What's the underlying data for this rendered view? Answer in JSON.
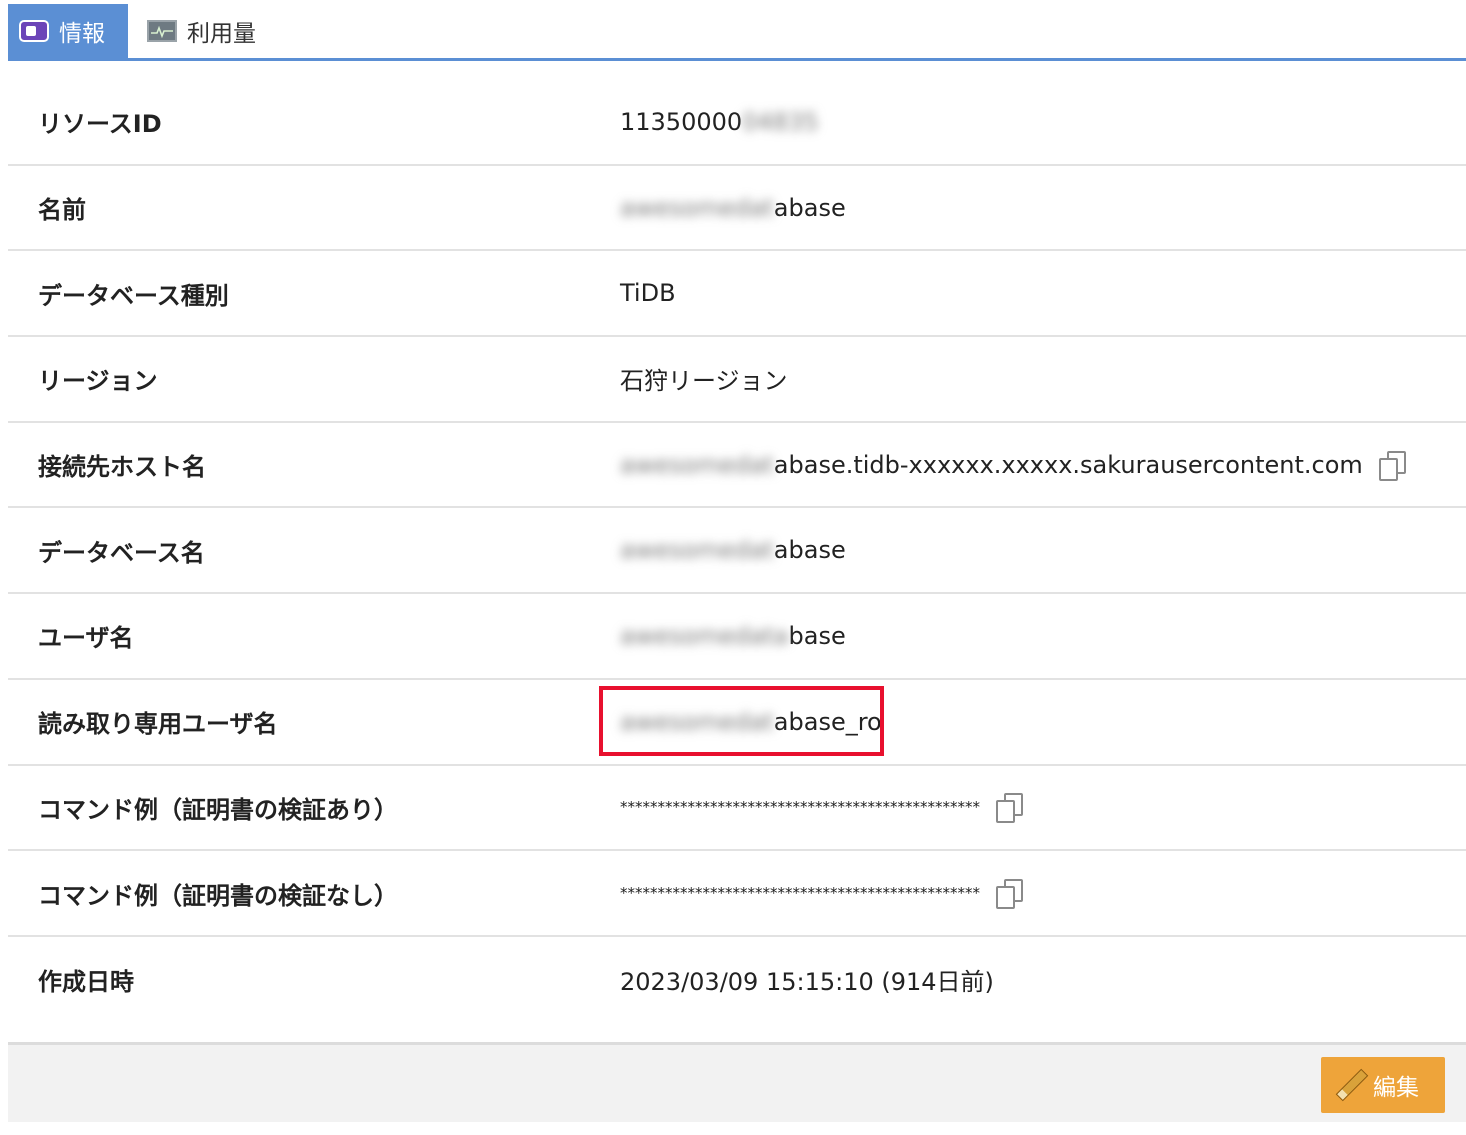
{
  "tabs": [
    {
      "label": "情報",
      "active": true,
      "icon": "info-card-icon"
    },
    {
      "label": "利用量",
      "active": false,
      "icon": "monitor-chart-icon"
    }
  ],
  "rows": [
    {
      "label": "リソースID",
      "value_visible": "11350000",
      "value_obscured": "04835"
    },
    {
      "label": "名前",
      "value_obscured": "awesomedat",
      "value_visible": "abase"
    },
    {
      "label": "データベース種別",
      "value_visible": "TiDB"
    },
    {
      "label": "リージョン",
      "value_visible": "石狩リージョン"
    },
    {
      "label": "接続先ホスト名",
      "value_obscured": "awesomedat",
      "value_visible": "abase.tidb-xxxxxx.xxxxx.sakurausercontent.com",
      "copy_icon": "copy-icon"
    },
    {
      "label": "データベース名",
      "value_obscured": "awesomedat",
      "value_visible": "abase"
    },
    {
      "label": "ユーザ名",
      "value_obscured": "awesomedata",
      "value_visible": "base"
    },
    {
      "label": "読み取り専用ユーザ名",
      "value_obscured": "awesomedat",
      "value_visible": "abase_ro",
      "highlighted": true
    },
    {
      "label": "コマンド例（証明書の検証あり）",
      "value_visible": "************************************************",
      "copy_icon": "copy-icon"
    },
    {
      "label": "コマンド例（証明書の検証なし）",
      "value_visible": "************************************************",
      "copy_icon": "copy-icon"
    },
    {
      "label": "作成日時",
      "value_visible": "2023/03/09 15:15:10 (914日前)"
    }
  ],
  "footer": {
    "edit_label": "編集",
    "edit_icon": "pencil-icon"
  },
  "colors": {
    "tab_active_bg": "#5b8fd4",
    "highlight_border": "#e8102e",
    "edit_button_bg": "#eea43a"
  }
}
